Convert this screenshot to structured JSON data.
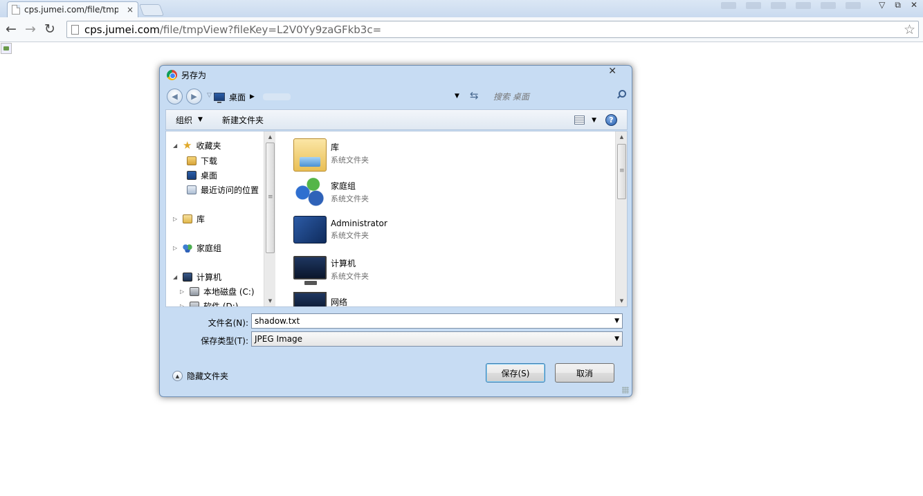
{
  "browser": {
    "tab_title": "cps.jumei.com/file/tmpVi",
    "tab_close": "×",
    "url_host": "cps.jumei.com",
    "url_rest": "/file/tmpView?fileKey=L2V0Yy9zaGFkb3c=",
    "back_icon": "back-arrow-icon",
    "forward_icon": "forward-arrow-icon",
    "reload_icon": "reload-icon",
    "bookmark_icon": "star-icon"
  },
  "dialog": {
    "title": "另存为",
    "close": "✕",
    "breadcrumb": "桌面",
    "search_placeholder": "搜索 桌面",
    "organize": "组织",
    "new_folder": "新建文件夹",
    "help": "?",
    "nav": {
      "favorites": "收藏夹",
      "downloads": "下载",
      "desktop": "桌面",
      "recent": "最近访问的位置",
      "libraries": "库",
      "homegroup": "家庭组",
      "computer": "计算机",
      "local_disk": "本地磁盘 (C:)",
      "software": "软件 (D:)"
    },
    "files": [
      {
        "name": "库",
        "type": "系统文件夹"
      },
      {
        "name": "家庭组",
        "type": "系统文件夹"
      },
      {
        "name": "Administrator",
        "type": "系统文件夹"
      },
      {
        "name": "计算机",
        "type": "系统文件夹"
      },
      {
        "name": "网络",
        "type": ""
      }
    ],
    "filename_label": "文件名(N):",
    "filename_value": "shadow.txt",
    "filetype_label": "保存类型(T):",
    "filetype_value": "JPEG Image",
    "hide_folders": "隐藏文件夹",
    "save": "保存(S)",
    "cancel": "取消"
  }
}
